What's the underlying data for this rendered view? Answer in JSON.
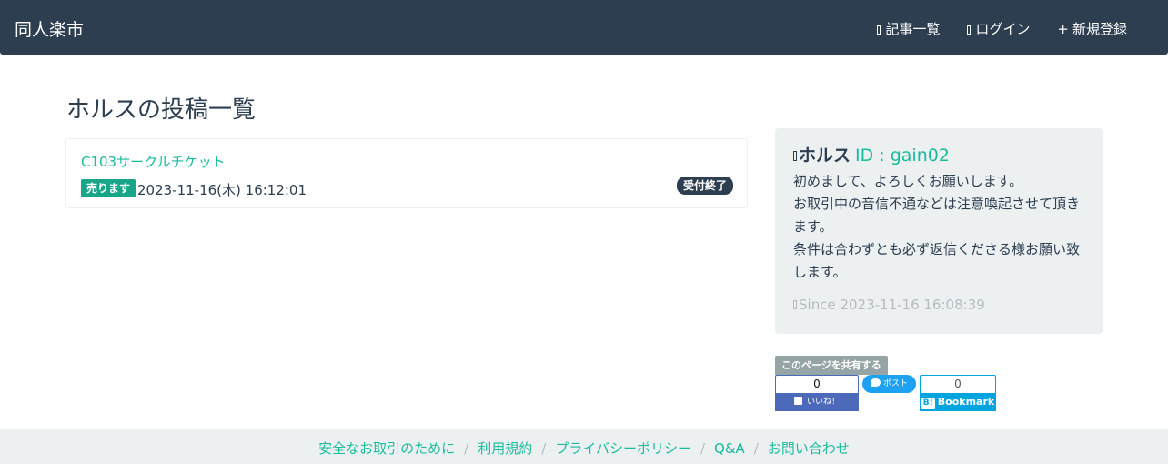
{
  "navbar": {
    "brand": "同人楽市",
    "links": [
      {
        "label": "記事一覧",
        "icon": "list-icon"
      },
      {
        "label": "ログイン",
        "icon": "login-icon"
      },
      {
        "label": "新規登録",
        "icon": "plus-icon"
      }
    ],
    "plus_symbol": "+"
  },
  "page": {
    "title": "ホルスの投稿一覧"
  },
  "posts": [
    {
      "title": "C103サークルチケット",
      "type_badge": "売ります",
      "date": "2023-11-16(木) 16:12:01",
      "status_badge": "受付終了"
    }
  ],
  "profile": {
    "name": "ホルス",
    "id_label": "ID : gain02",
    "bio_lines": [
      "初めまして、よろしくお願いします。",
      "お取引中の音信不通などは注意喚起させて頂き",
      "ます。",
      "条件は合わずとも必ず返信くださる様お願い致",
      "します。"
    ],
    "since": "Since 2023-11-16 16:08:39",
    "icons": {
      "user": "user-icon",
      "since": "clock-icon"
    }
  },
  "share": {
    "label": "このページを共有する",
    "facebook": {
      "count": "0",
      "button": "いいね！"
    },
    "twitter": {
      "button": "ポスト"
    },
    "hatena": {
      "count": "0",
      "logo": "B!",
      "button": "Bookmark"
    }
  },
  "footer": {
    "links": [
      "安全なお取引のために",
      "利用規約",
      "プライバシーポリシー",
      "Q&A",
      "お問い合わせ"
    ],
    "separator": "/"
  },
  "colors": {
    "navbar": "#2c3e50",
    "accent": "#18bc9c",
    "panel": "#ecf0f1",
    "sell_badge": "#18a58a",
    "facebook": "#4c69ba",
    "twitter": "#1da1f2",
    "hatena": "#00a4de"
  }
}
